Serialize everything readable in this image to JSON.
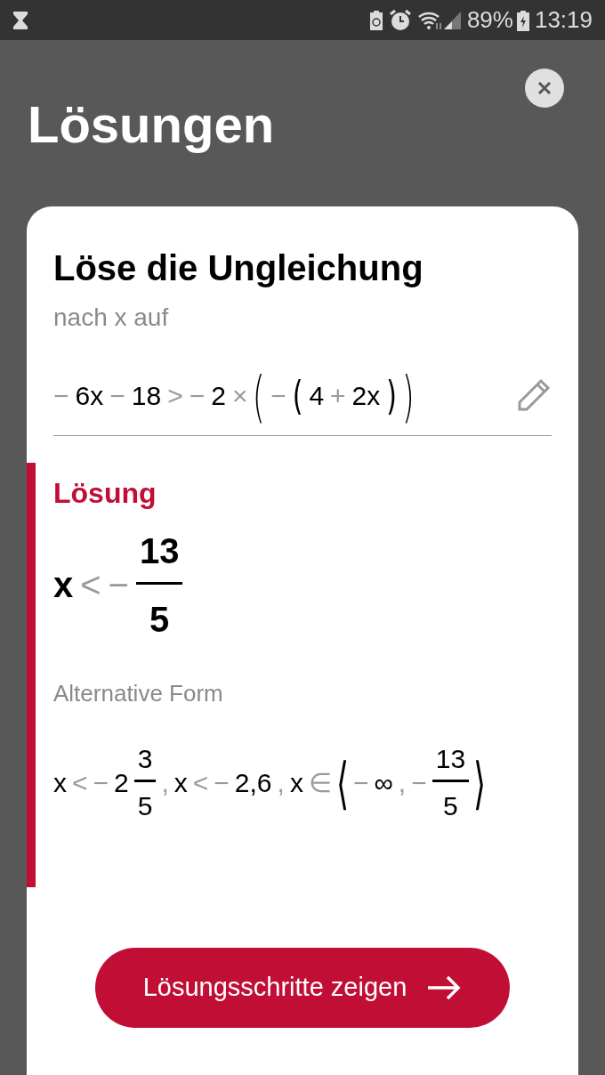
{
  "status_bar": {
    "battery": "89%",
    "time": "13:19"
  },
  "title": "Lösungen",
  "card": {
    "heading": "Löse die Ungleichung",
    "subtitle": "nach x auf",
    "problem": [
      {
        "kind": "op",
        "text": "−"
      },
      {
        "kind": "num",
        "text": "6x"
      },
      {
        "kind": "op",
        "text": "−"
      },
      {
        "kind": "num",
        "text": "18"
      },
      {
        "kind": "op",
        "text": ">"
      },
      {
        "kind": "op",
        "text": "−"
      },
      {
        "kind": "num",
        "text": "2"
      },
      {
        "kind": "op",
        "text": "×"
      },
      {
        "kind": "bigparen",
        "text": "("
      },
      {
        "kind": "op",
        "text": "−"
      },
      {
        "kind": "paren",
        "text": "("
      },
      {
        "kind": "num",
        "text": "4"
      },
      {
        "kind": "op",
        "text": "+"
      },
      {
        "kind": "num",
        "text": "2x"
      },
      {
        "kind": "paren",
        "text": ")"
      },
      {
        "kind": "bigparen",
        "text": ")"
      }
    ],
    "solution_label": "Lösung",
    "solution": [
      {
        "kind": "num",
        "text": "x"
      },
      {
        "kind": "op",
        "text": "<"
      },
      {
        "kind": "op",
        "text": "−"
      },
      {
        "kind": "frac",
        "num": "13",
        "den": "5"
      }
    ],
    "alternative_label": "Alternative Form",
    "alternative": [
      {
        "kind": "num",
        "text": "x"
      },
      {
        "kind": "op",
        "text": "<"
      },
      {
        "kind": "op",
        "text": "−"
      },
      {
        "kind": "num",
        "text": "2"
      },
      {
        "kind": "frac",
        "num": "3",
        "den": "5"
      },
      {
        "kind": "op",
        "text": ","
      },
      {
        "kind": "num",
        "text": "x"
      },
      {
        "kind": "op",
        "text": "<"
      },
      {
        "kind": "op",
        "text": "−"
      },
      {
        "kind": "num",
        "text": "2,6"
      },
      {
        "kind": "op",
        "text": ","
      },
      {
        "kind": "num",
        "text": "x"
      },
      {
        "kind": "op",
        "text": "∈"
      },
      {
        "kind": "bigparen",
        "text": "⟨"
      },
      {
        "kind": "op",
        "text": "−"
      },
      {
        "kind": "num",
        "text": "∞"
      },
      {
        "kind": "op",
        "text": ","
      },
      {
        "kind": "op",
        "text": "−"
      },
      {
        "kind": "frac",
        "num": "13",
        "den": "5"
      },
      {
        "kind": "bigparen",
        "text": "⟩"
      }
    ],
    "button": "Lösungsschritte zeigen"
  }
}
